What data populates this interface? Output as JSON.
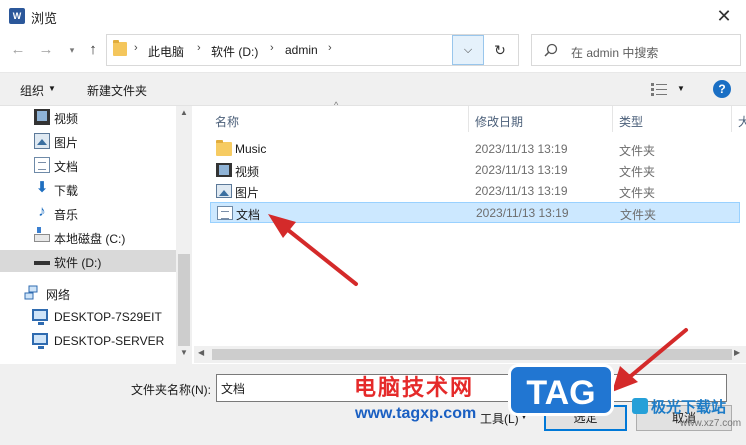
{
  "window": {
    "title": "浏览",
    "app_icon_letter": "W"
  },
  "address": {
    "crumbs": [
      "此电脑",
      "软件 (D:)",
      "admin"
    ],
    "search_placeholder": "在 admin 中搜索"
  },
  "toolbar": {
    "organize_label": "组织",
    "new_folder_label": "新建文件夹"
  },
  "sidebar": {
    "items": [
      {
        "label": "视频",
        "icon": "video-icon"
      },
      {
        "label": "图片",
        "icon": "picture-icon"
      },
      {
        "label": "文档",
        "icon": "document-icon"
      },
      {
        "label": "下载",
        "icon": "download-icon"
      },
      {
        "label": "音乐",
        "icon": "music-icon"
      },
      {
        "label": "本地磁盘 (C:)",
        "icon": "drive-icon"
      },
      {
        "label": "软件 (D:)",
        "icon": "drive-icon",
        "selected": true
      },
      {
        "label": "网络",
        "icon": "network-icon"
      },
      {
        "label": "DESKTOP-7S29EIT",
        "icon": "computer-icon"
      },
      {
        "label": "DESKTOP-SERVER",
        "icon": "computer-icon"
      }
    ]
  },
  "columns": {
    "name": "名称",
    "date": "修改日期",
    "type": "类型",
    "extra": "大"
  },
  "files": [
    {
      "name": "Music",
      "date": "2023/11/13 13:19",
      "type": "文件夹",
      "icon": "folder-icon"
    },
    {
      "name": "视频",
      "date": "2023/11/13 13:19",
      "type": "文件夹",
      "icon": "video-icon"
    },
    {
      "name": "图片",
      "date": "2023/11/13 13:19",
      "type": "文件夹",
      "icon": "picture-icon"
    },
    {
      "name": "文档",
      "date": "2023/11/13 13:19",
      "type": "文件夹",
      "icon": "document-icon",
      "selected": true
    }
  ],
  "bottom": {
    "folder_name_label": "文件夹名称(N):",
    "folder_name_value": "文档",
    "tools_label": "工具(L)",
    "select_label": "选定",
    "cancel_label": "取消"
  },
  "watermark": {
    "site_cn": "电脑技术网",
    "site_url": "www.tagxp.com",
    "tag": "TAG",
    "brand": "极光下载站",
    "brand_url": "www.xz7.com"
  }
}
